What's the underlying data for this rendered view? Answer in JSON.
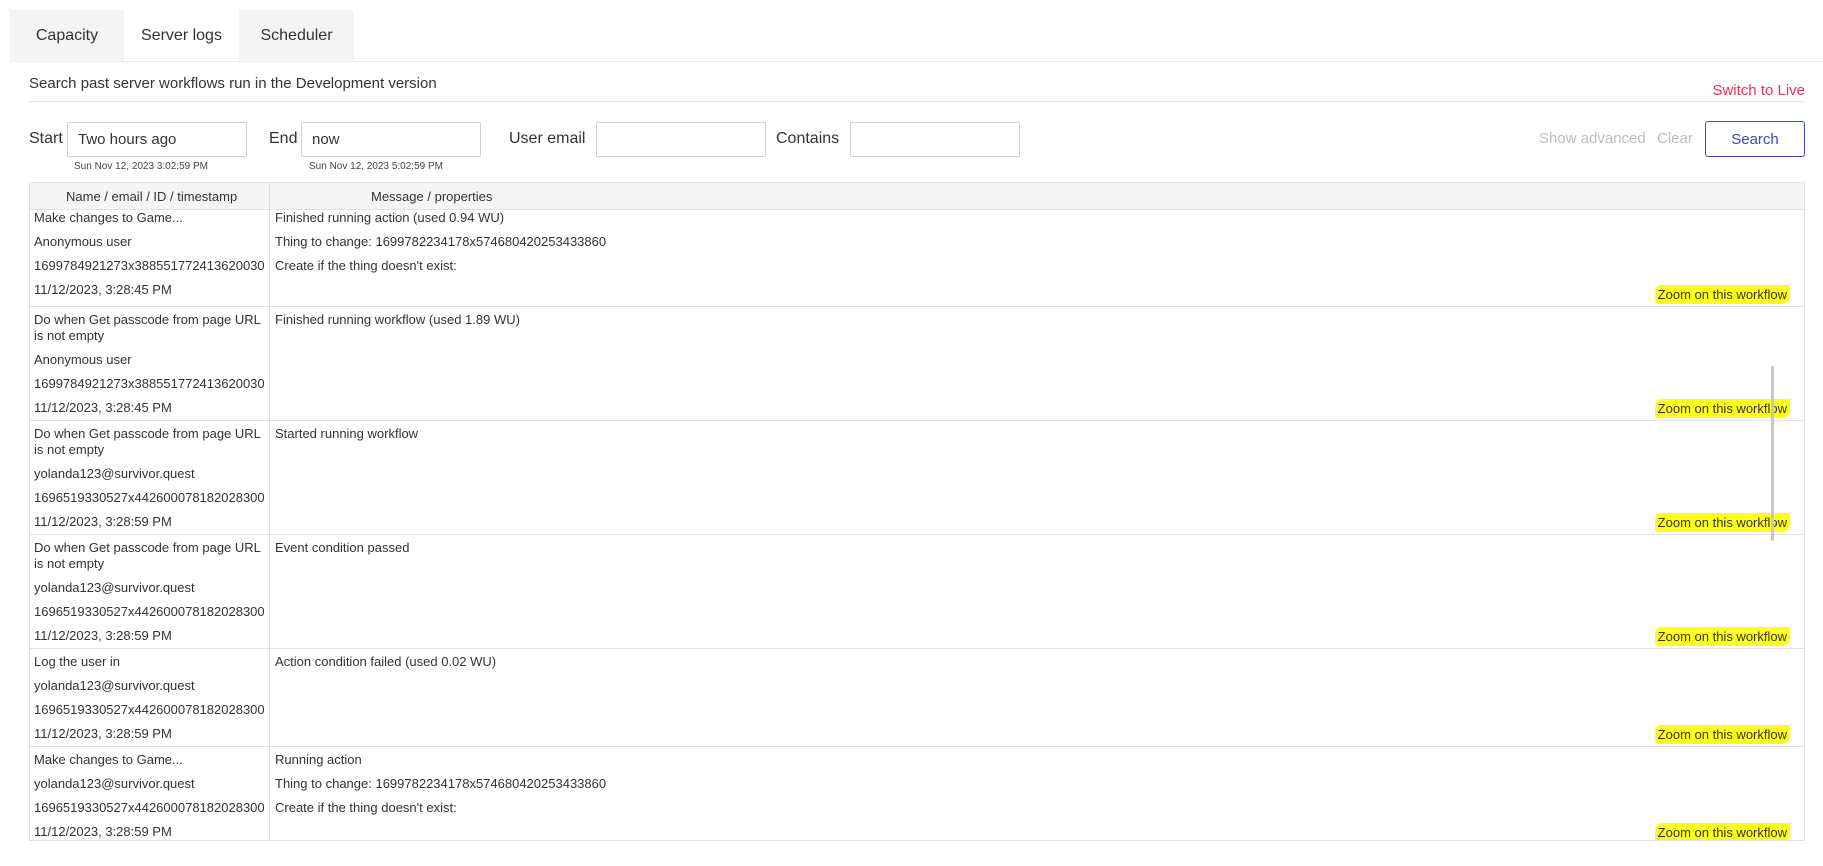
{
  "tabs": [
    {
      "label": "Capacity"
    },
    {
      "label": "Server logs"
    },
    {
      "label": "Scheduler"
    }
  ],
  "header": {
    "description": "Search past server workflows run in the Development version",
    "switch_live": "Switch to Live"
  },
  "filters": {
    "start_label": "Start",
    "start_value": "Two hours ago",
    "start_sub": "Sun Nov 12, 2023 3:02:59 PM",
    "end_label": "End",
    "end_value": "now",
    "end_sub": "Sun Nov 12, 2023 5:02:59 PM",
    "user_email_label": "User email",
    "user_email_value": "",
    "contains_label": "Contains",
    "contains_value": "",
    "show_advanced": "Show advanced",
    "clear": "Clear",
    "search": "Search"
  },
  "table": {
    "headers": [
      "Name / email / ID / timestamp",
      "Message / properties"
    ],
    "zoom_label": "Zoom on this workflow",
    "rows": [
      {
        "left": [
          "Make changes to Game...",
          "Anonymous user",
          "1699784921273x388551772413620030",
          "11/12/2023, 3:28:45 PM"
        ],
        "right": [
          "Finished running action (used 0.94 WU)",
          "Thing to change:  1699782234178x574680420253433860",
          "Create if the thing doesn't exist:"
        ]
      },
      {
        "left": [
          "Do when Get passcode from page URL is not empty",
          "Anonymous user",
          "1699784921273x388551772413620030",
          "11/12/2023, 3:28:45 PM"
        ],
        "right": [
          "Finished running workflow (used 1.89 WU)"
        ]
      },
      {
        "left": [
          "Do when Get passcode from page URL is not empty",
          "yolanda123@survivor.quest",
          "1696519330527x442600078182028300",
          "11/12/2023, 3:28:59 PM"
        ],
        "right": [
          "Started running workflow"
        ]
      },
      {
        "left": [
          "Do when Get passcode from page URL is not empty",
          "yolanda123@survivor.quest",
          "1696519330527x442600078182028300",
          "11/12/2023, 3:28:59 PM"
        ],
        "right": [
          "Event condition passed"
        ]
      },
      {
        "left": [
          "Log the user in",
          "yolanda123@survivor.quest",
          "1696519330527x442600078182028300",
          "11/12/2023, 3:28:59 PM"
        ],
        "right": [
          "Action condition failed (used 0.02 WU)"
        ]
      },
      {
        "left": [
          "Make changes to Game...",
          "yolanda123@survivor.quest",
          "1696519330527x442600078182028300",
          "11/12/2023, 3:28:59 PM"
        ],
        "right": [
          "Running action",
          "Thing to change:  1699782234178x574680420253433860",
          "Create if the thing doesn't exist:"
        ]
      }
    ]
  }
}
